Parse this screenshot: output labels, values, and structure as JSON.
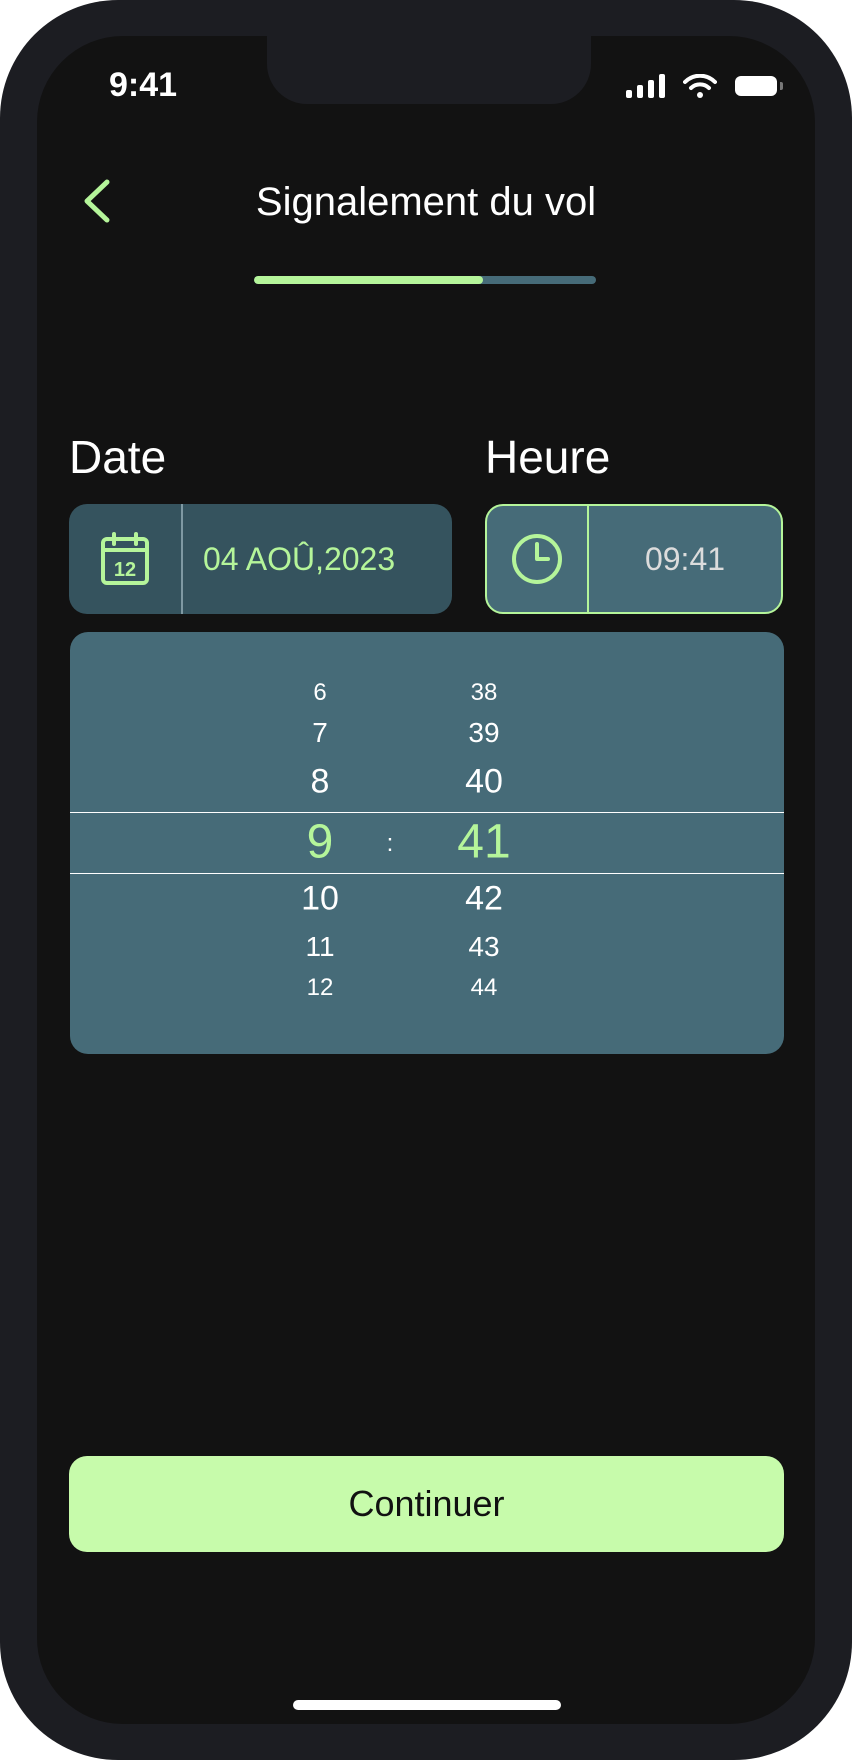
{
  "status_bar": {
    "time": "9:41"
  },
  "header": {
    "title": "Signalement du vol",
    "progress": 0.67
  },
  "date": {
    "label": "Date",
    "value": "04 AOÛ,2023",
    "icon": "calendar-icon",
    "icon_day": "12"
  },
  "time": {
    "label": "Heure",
    "value": "09:41",
    "icon": "clock-icon"
  },
  "picker": {
    "hours": [
      "6",
      "7",
      "8",
      "9",
      "10",
      "11",
      "12"
    ],
    "minutes": [
      "38",
      "39",
      "40",
      "41",
      "42",
      "43",
      "44"
    ],
    "separator": ":",
    "selected_index": 3
  },
  "footer": {
    "continue_label": "Continuer"
  },
  "colors": {
    "accent": "#b5f59a",
    "button": "#c7fbab",
    "background": "#121212",
    "panel": "#466b78"
  }
}
